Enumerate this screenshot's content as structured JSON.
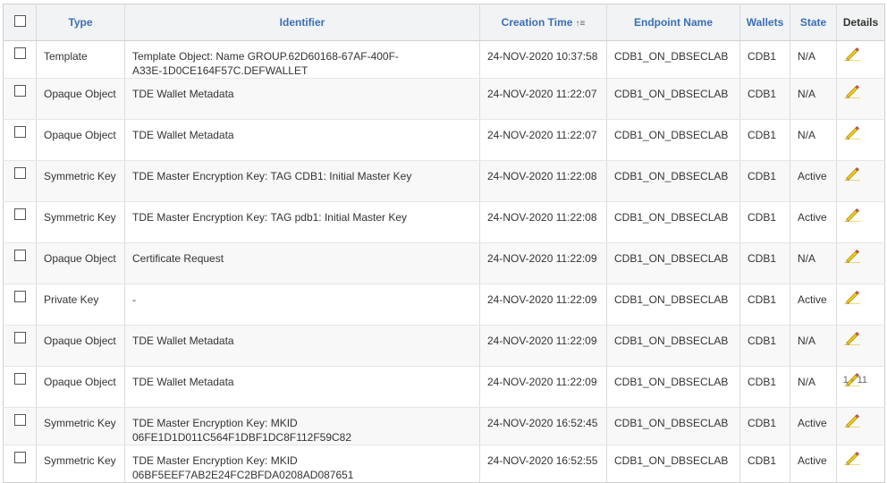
{
  "columns": {
    "type": "Type",
    "identifier": "Identifier",
    "creation_time": "Creation Time",
    "endpoint_name": "Endpoint Name",
    "wallets": "Wallets",
    "state": "State",
    "details": "Details"
  },
  "sort_icon": "sort-ascending-icon",
  "rows": [
    {
      "type": "Template",
      "identifier": [
        "Template Object: Name GROUP.62D60168-67AF-400F-",
        "A33E-1D0CE164F57C.DEFWALLET"
      ],
      "time": "24-NOV-2020 10:37:58",
      "endpoint": "CDB1_ON_DBSECLAB",
      "wallet": "CDB1",
      "state": "N/A"
    },
    {
      "type": "Opaque Object",
      "identifier": [
        "TDE Wallet Metadata"
      ],
      "time": "24-NOV-2020 11:22:07",
      "endpoint": "CDB1_ON_DBSECLAB",
      "wallet": "CDB1",
      "state": "N/A"
    },
    {
      "type": "Opaque Object",
      "identifier": [
        "TDE Wallet Metadata"
      ],
      "time": "24-NOV-2020 11:22:07",
      "endpoint": "CDB1_ON_DBSECLAB",
      "wallet": "CDB1",
      "state": "N/A"
    },
    {
      "type": "Symmetric Key",
      "identifier": [
        "TDE Master Encryption Key: TAG CDB1: Initial Master Key"
      ],
      "time": "24-NOV-2020 11:22:08",
      "endpoint": "CDB1_ON_DBSECLAB",
      "wallet": "CDB1",
      "state": "Active"
    },
    {
      "type": "Symmetric Key",
      "identifier": [
        "TDE Master Encryption Key: TAG pdb1: Initial Master Key"
      ],
      "time": "24-NOV-2020 11:22:08",
      "endpoint": "CDB1_ON_DBSECLAB",
      "wallet": "CDB1",
      "state": "Active"
    },
    {
      "type": "Opaque Object",
      "identifier": [
        "Certificate Request"
      ],
      "time": "24-NOV-2020 11:22:09",
      "endpoint": "CDB1_ON_DBSECLAB",
      "wallet": "CDB1",
      "state": "N/A"
    },
    {
      "type": "Private Key",
      "identifier": [
        "-"
      ],
      "time": "24-NOV-2020 11:22:09",
      "endpoint": "CDB1_ON_DBSECLAB",
      "wallet": "CDB1",
      "state": "Active"
    },
    {
      "type": "Opaque Object",
      "identifier": [
        "TDE Wallet Metadata"
      ],
      "time": "24-NOV-2020 11:22:09",
      "endpoint": "CDB1_ON_DBSECLAB",
      "wallet": "CDB1",
      "state": "N/A"
    },
    {
      "type": "Opaque Object",
      "identifier": [
        "TDE Wallet Metadata"
      ],
      "time": "24-NOV-2020 11:22:09",
      "endpoint": "CDB1_ON_DBSECLAB",
      "wallet": "CDB1",
      "state": "N/A"
    },
    {
      "type": "Symmetric Key",
      "identifier": [
        "TDE Master Encryption Key: MKID",
        "06FE1D1D011C564F1DBF1DC8F112F59C82"
      ],
      "time": "24-NOV-2020 16:52:45",
      "endpoint": "CDB1_ON_DBSECLAB",
      "wallet": "CDB1",
      "state": "Active"
    },
    {
      "type": "Symmetric Key",
      "identifier": [
        "TDE Master Encryption Key: MKID",
        "06BF5EEF7AB2E24FC2BFDA0208AD087651"
      ],
      "time": "24-NOV-2020 16:52:55",
      "endpoint": "CDB1_ON_DBSECLAB",
      "wallet": "CDB1",
      "state": "Active"
    }
  ],
  "details_icon": "pencil-edit-icon",
  "pager": {
    "range": "1 - 11"
  },
  "colors": {
    "header_text": "#3a6fb6",
    "header_bg": "#f2f3f4",
    "pencil": "#e8c200"
  }
}
